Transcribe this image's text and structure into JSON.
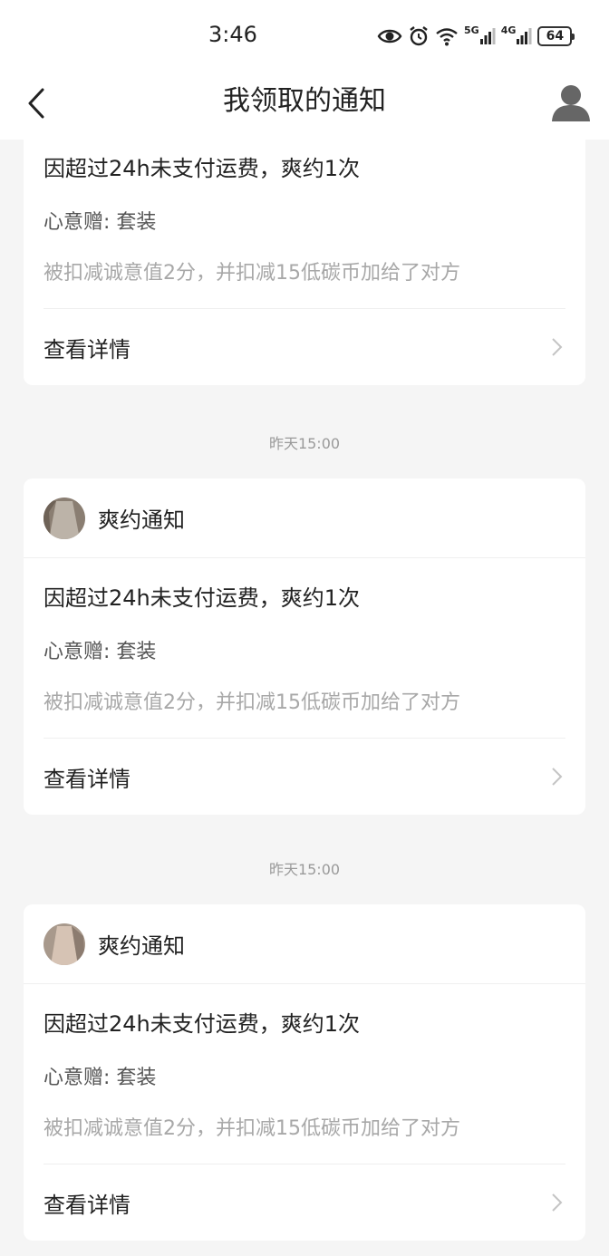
{
  "status": {
    "time": "3:46",
    "sig5g": "5G",
    "sig4g": "4G",
    "battery": "64"
  },
  "nav": {
    "title": "我领取的通知"
  },
  "cards": [
    {
      "sender": "",
      "main": "因超过24h未支付运费，爽约1次",
      "item": "心意赠: 套装",
      "desc": "被扣减诚意值2分，并扣减15低碳币加给了对方",
      "detail": "查看详情"
    },
    {
      "time": "昨天15:00",
      "sender": "爽约通知",
      "main": "因超过24h未支付运费，爽约1次",
      "item": "心意赠: 套装",
      "desc": "被扣减诚意值2分，并扣减15低碳币加给了对方",
      "detail": "查看详情"
    },
    {
      "time": "昨天15:00",
      "sender": "爽约通知",
      "main": "因超过24h未支付运费，爽约1次",
      "item": "心意赠: 套装",
      "desc": "被扣减诚意值2分，并扣减15低碳币加给了对方",
      "detail": "查看详情"
    }
  ],
  "icons": {
    "back": "back-arrow-icon",
    "profile": "user-profile-icon",
    "chevron": "chevron-right-icon"
  }
}
